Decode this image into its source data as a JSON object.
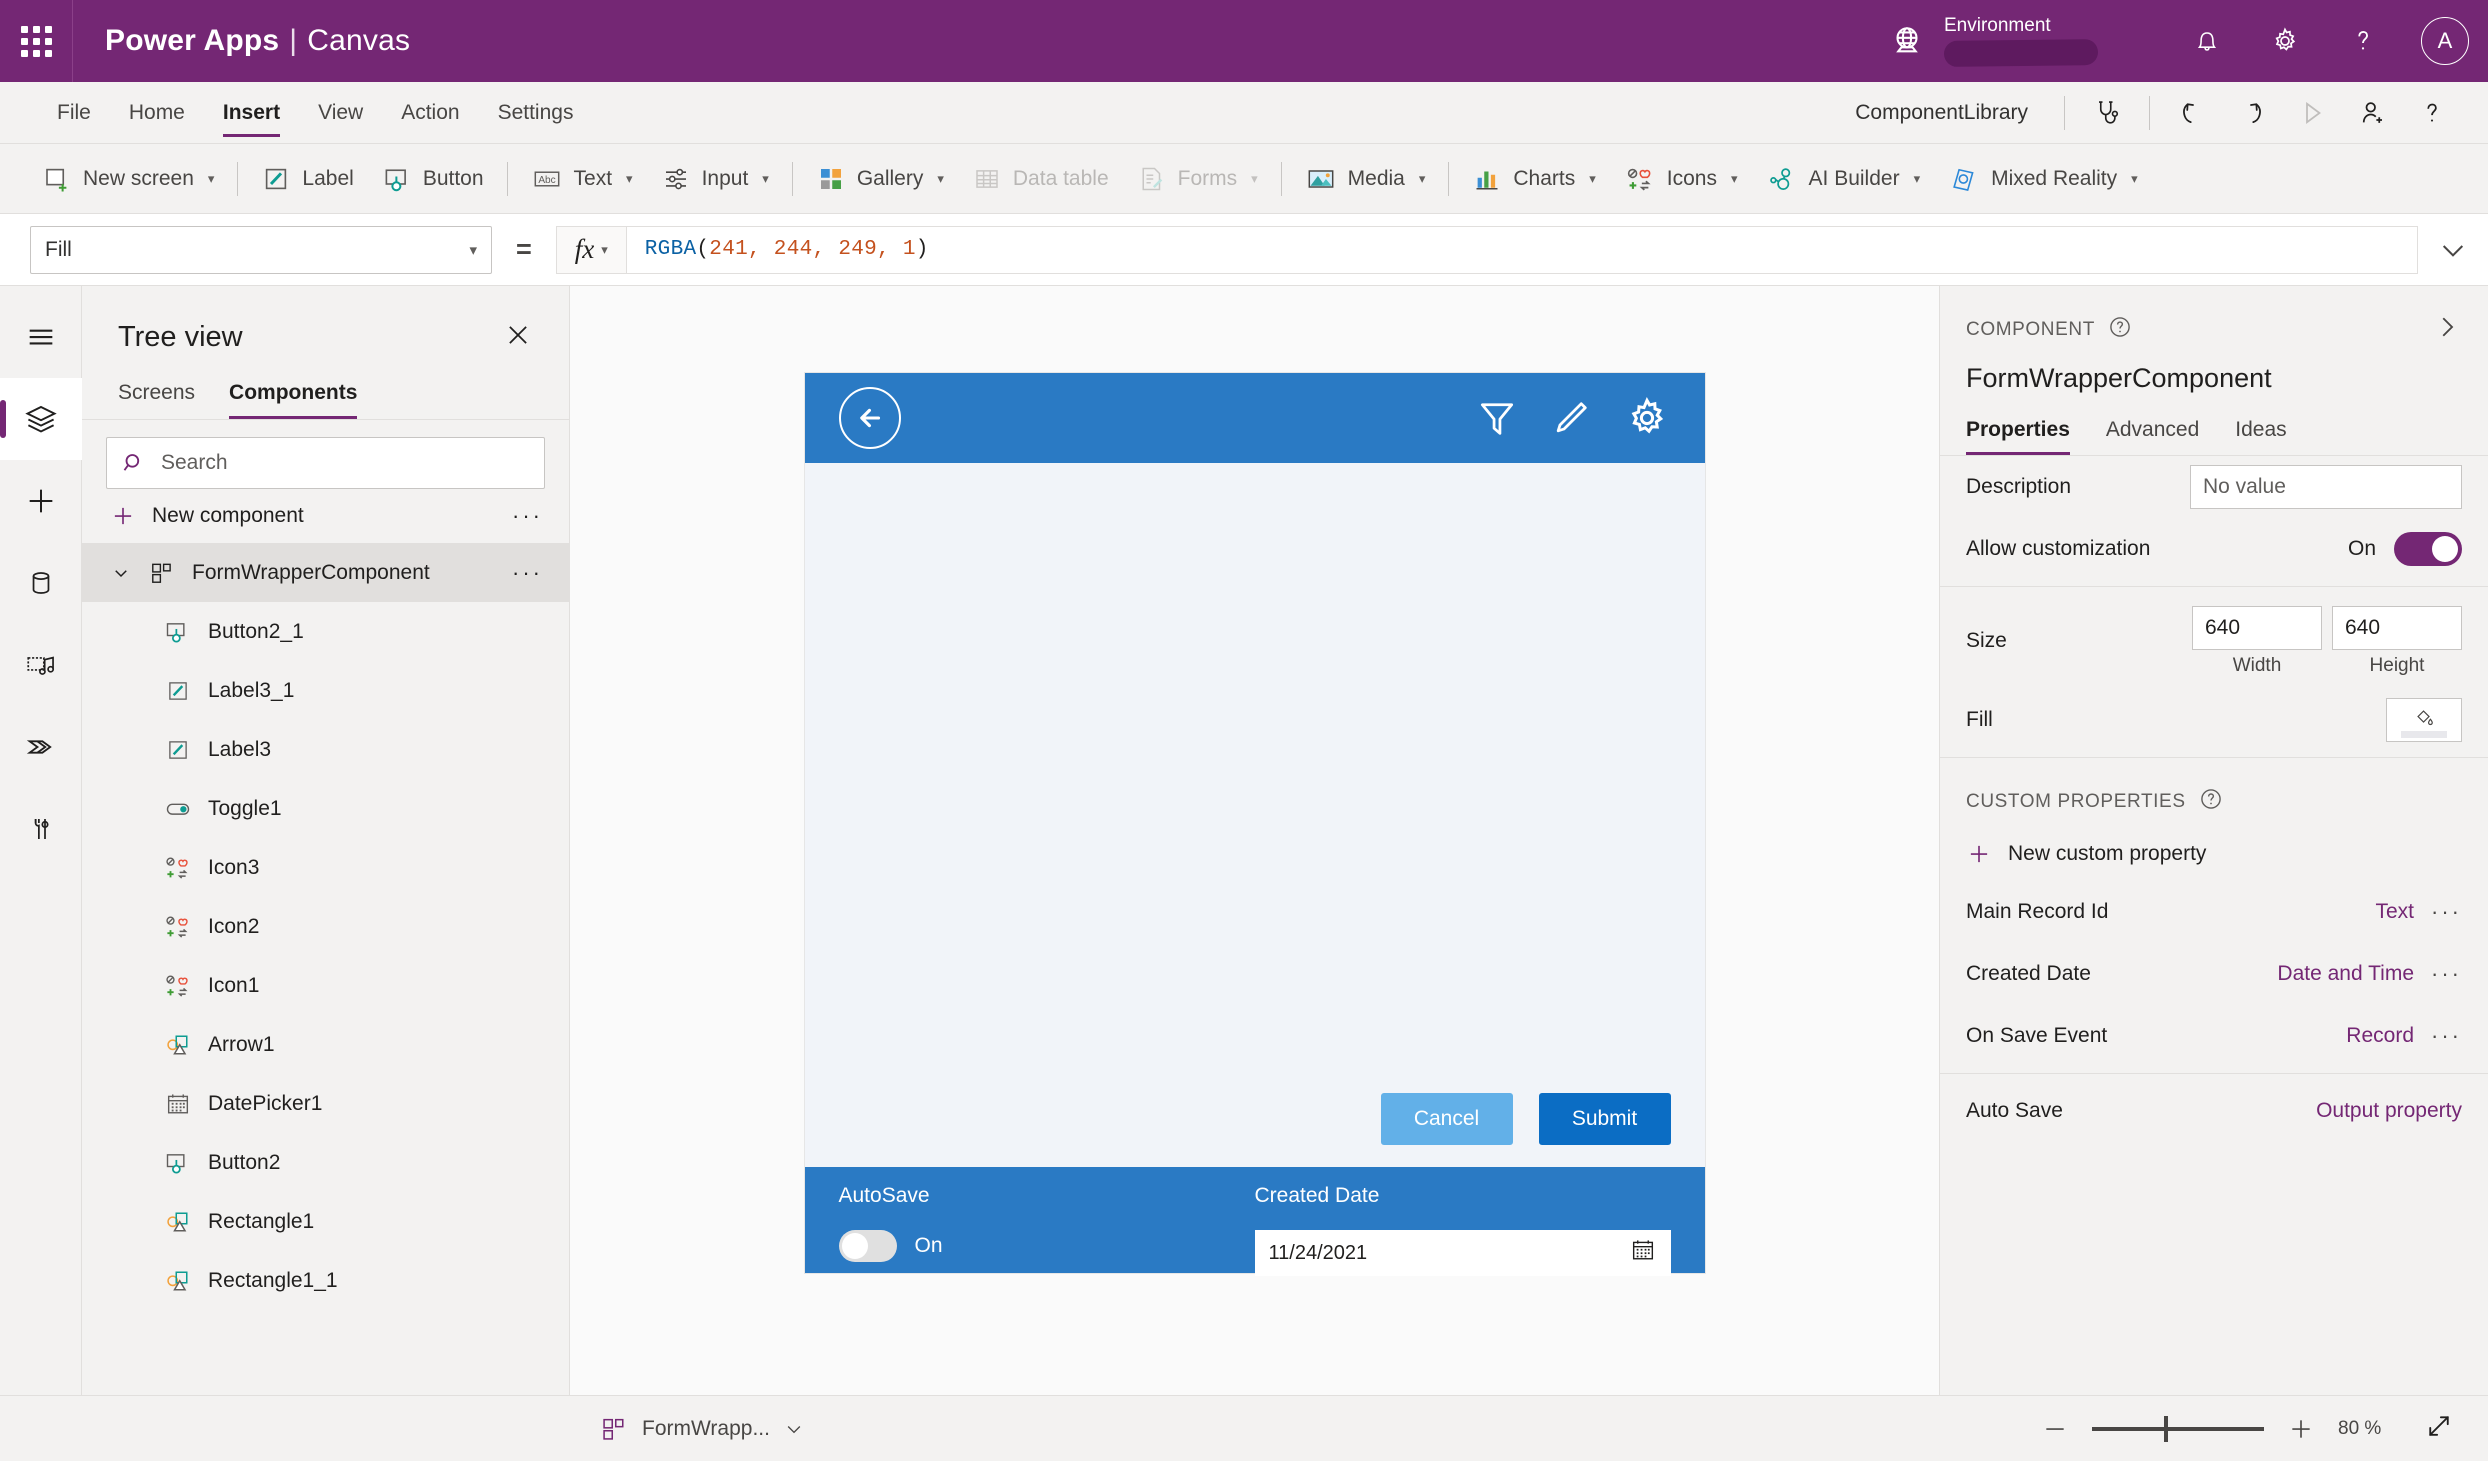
{
  "brand": {
    "app_name": "Power Apps",
    "separator": "|",
    "mode": "Canvas",
    "waffle_icon": "app-launcher-icon",
    "environment_label": "Environment",
    "globe_icon": "globe-icon",
    "notification_icon": "bell-icon",
    "settings_icon": "gear-icon",
    "help_icon": "question-mark-icon",
    "avatar_initial": "A",
    "bar_color": "#742774"
  },
  "menubar": {
    "items": [
      {
        "label": "File",
        "active": false
      },
      {
        "label": "Home",
        "active": false
      },
      {
        "label": "Insert",
        "active": true
      },
      {
        "label": "View",
        "active": false
      },
      {
        "label": "Action",
        "active": false
      },
      {
        "label": "Settings",
        "active": false
      }
    ],
    "library_name": "ComponentLibrary",
    "icons": [
      "stethoscope-icon",
      "undo-icon",
      "redo-icon",
      "play-icon",
      "share-user-icon",
      "question-mark-icon"
    ]
  },
  "ribbon": {
    "items": [
      {
        "label": "New screen",
        "icon": "new-screen-icon",
        "caret": true,
        "disabled": false
      },
      {
        "label": "Label",
        "icon": "label-icon",
        "caret": false,
        "disabled": false
      },
      {
        "label": "Button",
        "icon": "button-icon",
        "caret": false,
        "disabled": false
      },
      {
        "label": "Text",
        "icon": "text-abc-icon",
        "caret": true,
        "disabled": false
      },
      {
        "label": "Input",
        "icon": "input-sliders-icon",
        "caret": true,
        "disabled": false
      },
      {
        "label": "Gallery",
        "icon": "gallery-icon",
        "caret": true,
        "disabled": false
      },
      {
        "label": "Data table",
        "icon": "data-table-icon",
        "caret": false,
        "disabled": true
      },
      {
        "label": "Forms",
        "icon": "forms-icon",
        "caret": true,
        "disabled": true
      },
      {
        "label": "Media",
        "icon": "media-image-icon",
        "caret": true,
        "disabled": false
      },
      {
        "label": "Charts",
        "icon": "charts-bar-icon",
        "caret": true,
        "disabled": false
      },
      {
        "label": "Icons",
        "icon": "icons-shapes-icon",
        "caret": true,
        "disabled": false
      },
      {
        "label": "AI Builder",
        "icon": "ai-builder-icon",
        "caret": true,
        "disabled": false
      },
      {
        "label": "Mixed Reality",
        "icon": "mixed-reality-icon",
        "caret": true,
        "disabled": false
      }
    ]
  },
  "formula_bar": {
    "property": "Fill",
    "equals": "=",
    "fx_glyph": "fx",
    "formula_function": "RGBA",
    "formula_open": "(",
    "formula_args": "241, 244, 249, 1",
    "formula_close": ")",
    "formula_full": "RGBA(241, 244, 249, 1)"
  },
  "rail": {
    "items": [
      {
        "name": "hamburger-menu-icon",
        "selected": false
      },
      {
        "name": "tree-view-layers-icon",
        "selected": true
      },
      {
        "name": "insert-plus-icon",
        "selected": false
      },
      {
        "name": "data-cylinder-icon",
        "selected": false
      },
      {
        "name": "media-icon",
        "selected": false
      },
      {
        "name": "power-automate-icon",
        "selected": false
      },
      {
        "name": "variables-tools-icon",
        "selected": false
      }
    ]
  },
  "tree_view": {
    "title": "Tree view",
    "close_icon": "close-icon",
    "tabs": [
      {
        "label": "Screens",
        "active": false
      },
      {
        "label": "Components",
        "active": true
      }
    ],
    "search_placeholder": "Search",
    "search_value": "",
    "search_icon": "search-icon",
    "new_component_label": "New component",
    "new_component_icon": "plus-icon",
    "overflow_dots": "···",
    "parent": {
      "label": "FormWrapperComponent",
      "icon": "component-icon",
      "caret": "chevron-down-icon",
      "expanded": true
    },
    "children": [
      {
        "label": "Button2_1",
        "icon": "button-icon"
      },
      {
        "label": "Label3_1",
        "icon": "label-icon"
      },
      {
        "label": "Label3",
        "icon": "label-icon"
      },
      {
        "label": "Toggle1",
        "icon": "toggle-icon"
      },
      {
        "label": "Icon3",
        "icon": "icons-shapes-icon"
      },
      {
        "label": "Icon2",
        "icon": "icons-shapes-icon"
      },
      {
        "label": "Icon1",
        "icon": "icons-shapes-icon"
      },
      {
        "label": "Arrow1",
        "icon": "shapes-icon"
      },
      {
        "label": "DatePicker1",
        "icon": "calendar-icon"
      },
      {
        "label": "Button2",
        "icon": "button-icon"
      },
      {
        "label": "Rectangle1",
        "icon": "shapes-icon"
      },
      {
        "label": "Rectangle1_1",
        "icon": "shapes-icon"
      }
    ]
  },
  "canvas": {
    "header": {
      "back_icon": "back-arrow-circle-icon",
      "actions": [
        "filter-icon",
        "edit-pencil-icon",
        "settings-gear-icon"
      ],
      "bg_color": "#2a7ac4"
    },
    "body_color": "#f1f4f9",
    "buttons": [
      {
        "label": "Cancel",
        "color": "#62b0e8"
      },
      {
        "label": "Submit",
        "color": "#0b6dc4"
      }
    ],
    "footer": {
      "autosave_label": "AutoSave",
      "toggle_state": "On",
      "created_date_label": "Created Date",
      "created_date_value": "11/24/2021",
      "calendar_icon": "calendar-icon",
      "bg_color": "#2a7ac4"
    }
  },
  "properties_panel": {
    "kicker": "COMPONENT",
    "help_icon": "question-circle-icon",
    "expand_icon": "chevron-right-icon",
    "component_name": "FormWrapperComponent",
    "tabs": [
      {
        "label": "Properties",
        "active": true
      },
      {
        "label": "Advanced",
        "active": false
      },
      {
        "label": "Ideas",
        "active": false
      }
    ],
    "description_label": "Description",
    "description_placeholder": "No value",
    "allow_customization_label": "Allow customization",
    "allow_customization_state": "On",
    "size_label": "Size",
    "size_width": "640",
    "size_height": "640",
    "width_caption": "Width",
    "height_caption": "Height",
    "fill_label": "Fill",
    "fill_icon": "paint-bucket-icon",
    "custom_properties_header": "CUSTOM PROPERTIES",
    "new_custom_property_label": "New custom property",
    "new_custom_property_icon": "plus-icon",
    "custom_properties": [
      {
        "name": "Main Record Id",
        "type": "Text",
        "dots": "···"
      },
      {
        "name": "Created Date",
        "type": "Date and Time",
        "dots": "···"
      },
      {
        "name": "On Save Event",
        "type": "Record",
        "dots": "···"
      }
    ],
    "output_property": {
      "name": "Auto Save",
      "type": "Output property"
    },
    "accent_color": "#742774"
  },
  "statusbar": {
    "component_name": "FormWrapp...",
    "component_icon": "component-icon",
    "caret_icon": "chevron-down-icon",
    "zoom_out_icon": "minus-icon",
    "zoom_in_icon": "plus-icon",
    "zoom_value": "80",
    "zoom_unit": "%",
    "fit_icon": "fit-screen-icon"
  }
}
